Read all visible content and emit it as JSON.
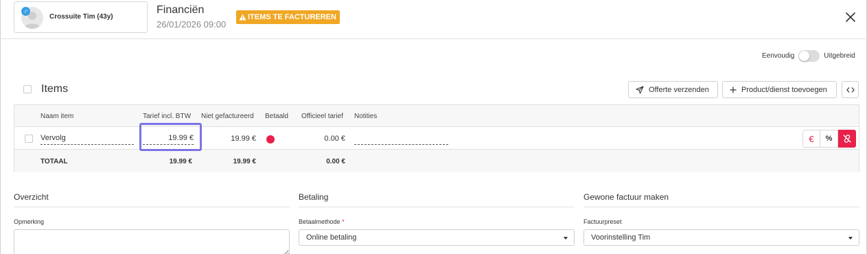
{
  "header": {
    "patient_name": "Crossuite Tim (43y)",
    "gender_symbol": "♂",
    "title": "Financiën",
    "datetime": "26/01/2026 09:00",
    "badge": "ITEMS TE FACTUREREN",
    "badge_color": "#f0a724"
  },
  "view_toggle": {
    "left_label": "Eenvoudig",
    "right_label": "Uitgebreid",
    "state": "off"
  },
  "items": {
    "title": "Items",
    "buttons": {
      "send_quote": "Offerte verzenden",
      "add_product": "Product/dienst toevoegen",
      "code_toggle": "<>"
    },
    "columns": [
      "Naam item",
      "Tarief incl. BTW",
      "Niet gefactureerd",
      "Betaald",
      "Officieel tarief",
      "Notities"
    ],
    "rows": [
      {
        "name": "Vervolg",
        "rate": "19.99 €",
        "unbilled": "19.99 €",
        "paid_status_color": "#e8204a",
        "official_rate": "0.00 €",
        "notes": ""
      }
    ],
    "total": {
      "label": "TOTAAL",
      "rate": "19.99 €",
      "unbilled": "19.99 €",
      "official_rate": "0.00 €"
    },
    "row_actions": {
      "euro": "€",
      "percent": "%"
    }
  },
  "overview": {
    "title": "Overzicht",
    "remark_label": "Opmerking",
    "remark_value": ""
  },
  "payment": {
    "title": "Betaling",
    "method_label": "Betaalmethode",
    "required_mark": "*",
    "method_value": "Online betaling"
  },
  "invoice": {
    "title": "Gewone factuur maken",
    "preset_label": "Factuurpreset",
    "preset_value": "Voorinstelling Tim"
  },
  "colors": {
    "accent_red": "#e8204a",
    "highlight_purple": "#7b73e6",
    "warning_orange": "#f0a724"
  }
}
